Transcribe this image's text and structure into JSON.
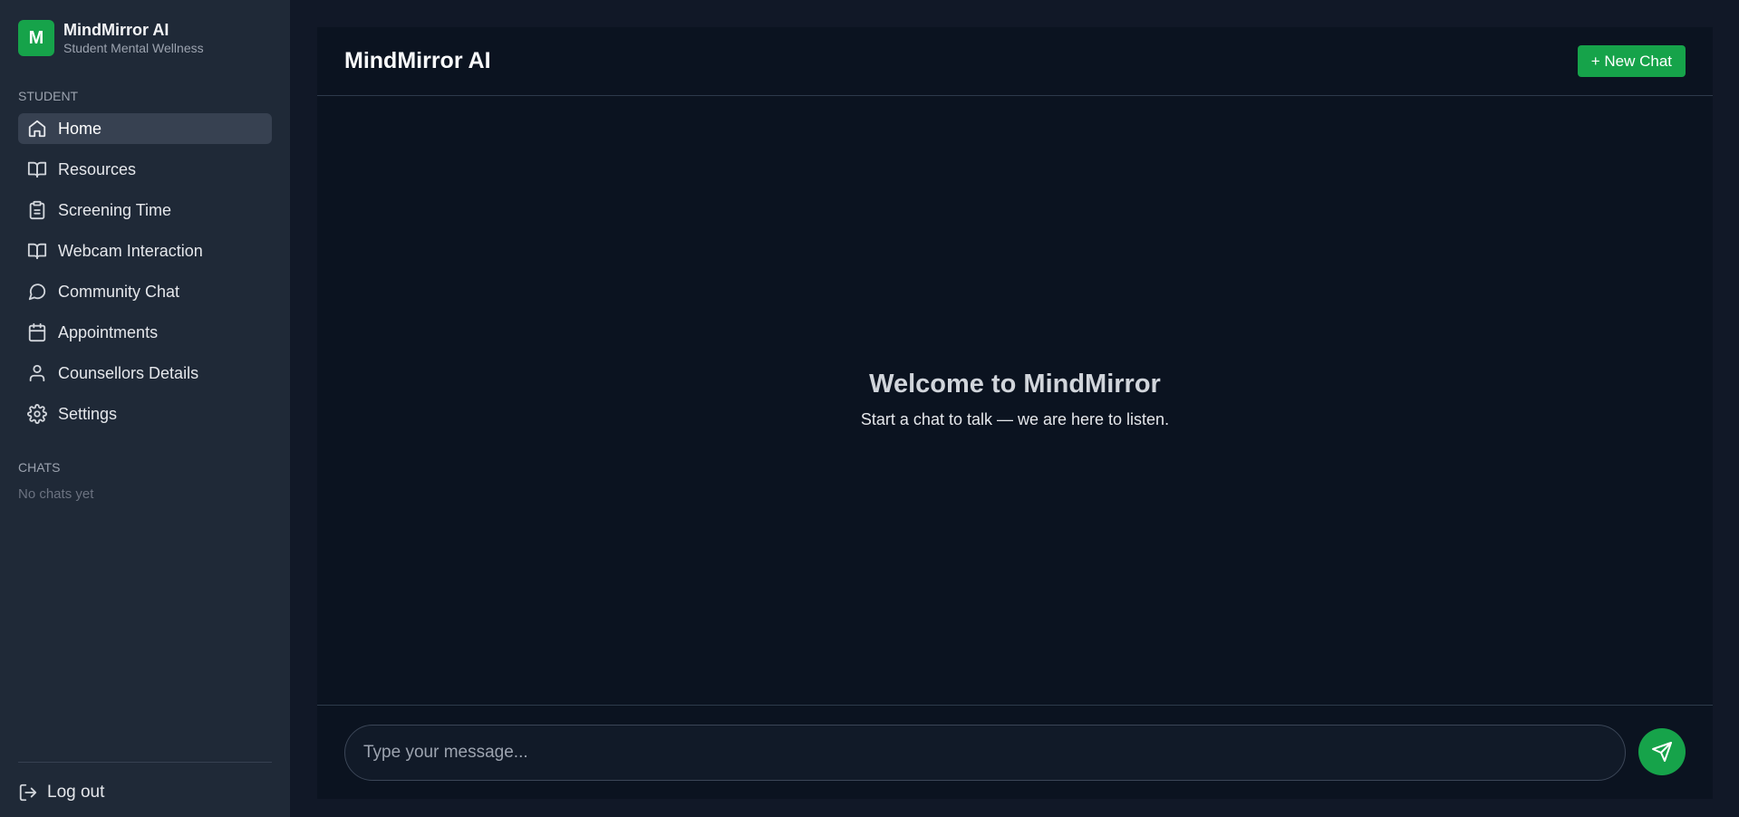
{
  "brand": {
    "logo_letter": "M",
    "title": "MindMirror AI",
    "subtitle": "Student Mental Wellness",
    "accent_color": "#16a34a"
  },
  "sidebar": {
    "section_student": "STUDENT",
    "items": [
      {
        "label": "Home",
        "icon": "home-icon",
        "active": true
      },
      {
        "label": "Resources",
        "icon": "book-icon",
        "active": false
      },
      {
        "label": "Screening Time",
        "icon": "clipboard-icon",
        "active": false
      },
      {
        "label": "Webcam Interaction",
        "icon": "book-icon",
        "active": false
      },
      {
        "label": "Community Chat",
        "icon": "message-circle-icon",
        "active": false
      },
      {
        "label": "Appointments",
        "icon": "calendar-icon",
        "active": false
      },
      {
        "label": "Counsellors Details",
        "icon": "user-icon",
        "active": false
      },
      {
        "label": "Settings",
        "icon": "gear-icon",
        "active": false
      }
    ],
    "section_chats": "CHATS",
    "no_chats": "No chats yet",
    "logout_label": "Log out"
  },
  "main": {
    "title": "MindMirror AI",
    "new_chat_label": "+ New Chat",
    "welcome_title": "Welcome to MindMirror",
    "welcome_text": "Start a chat to talk — we are here to listen.",
    "input_placeholder": "Type your message..."
  }
}
